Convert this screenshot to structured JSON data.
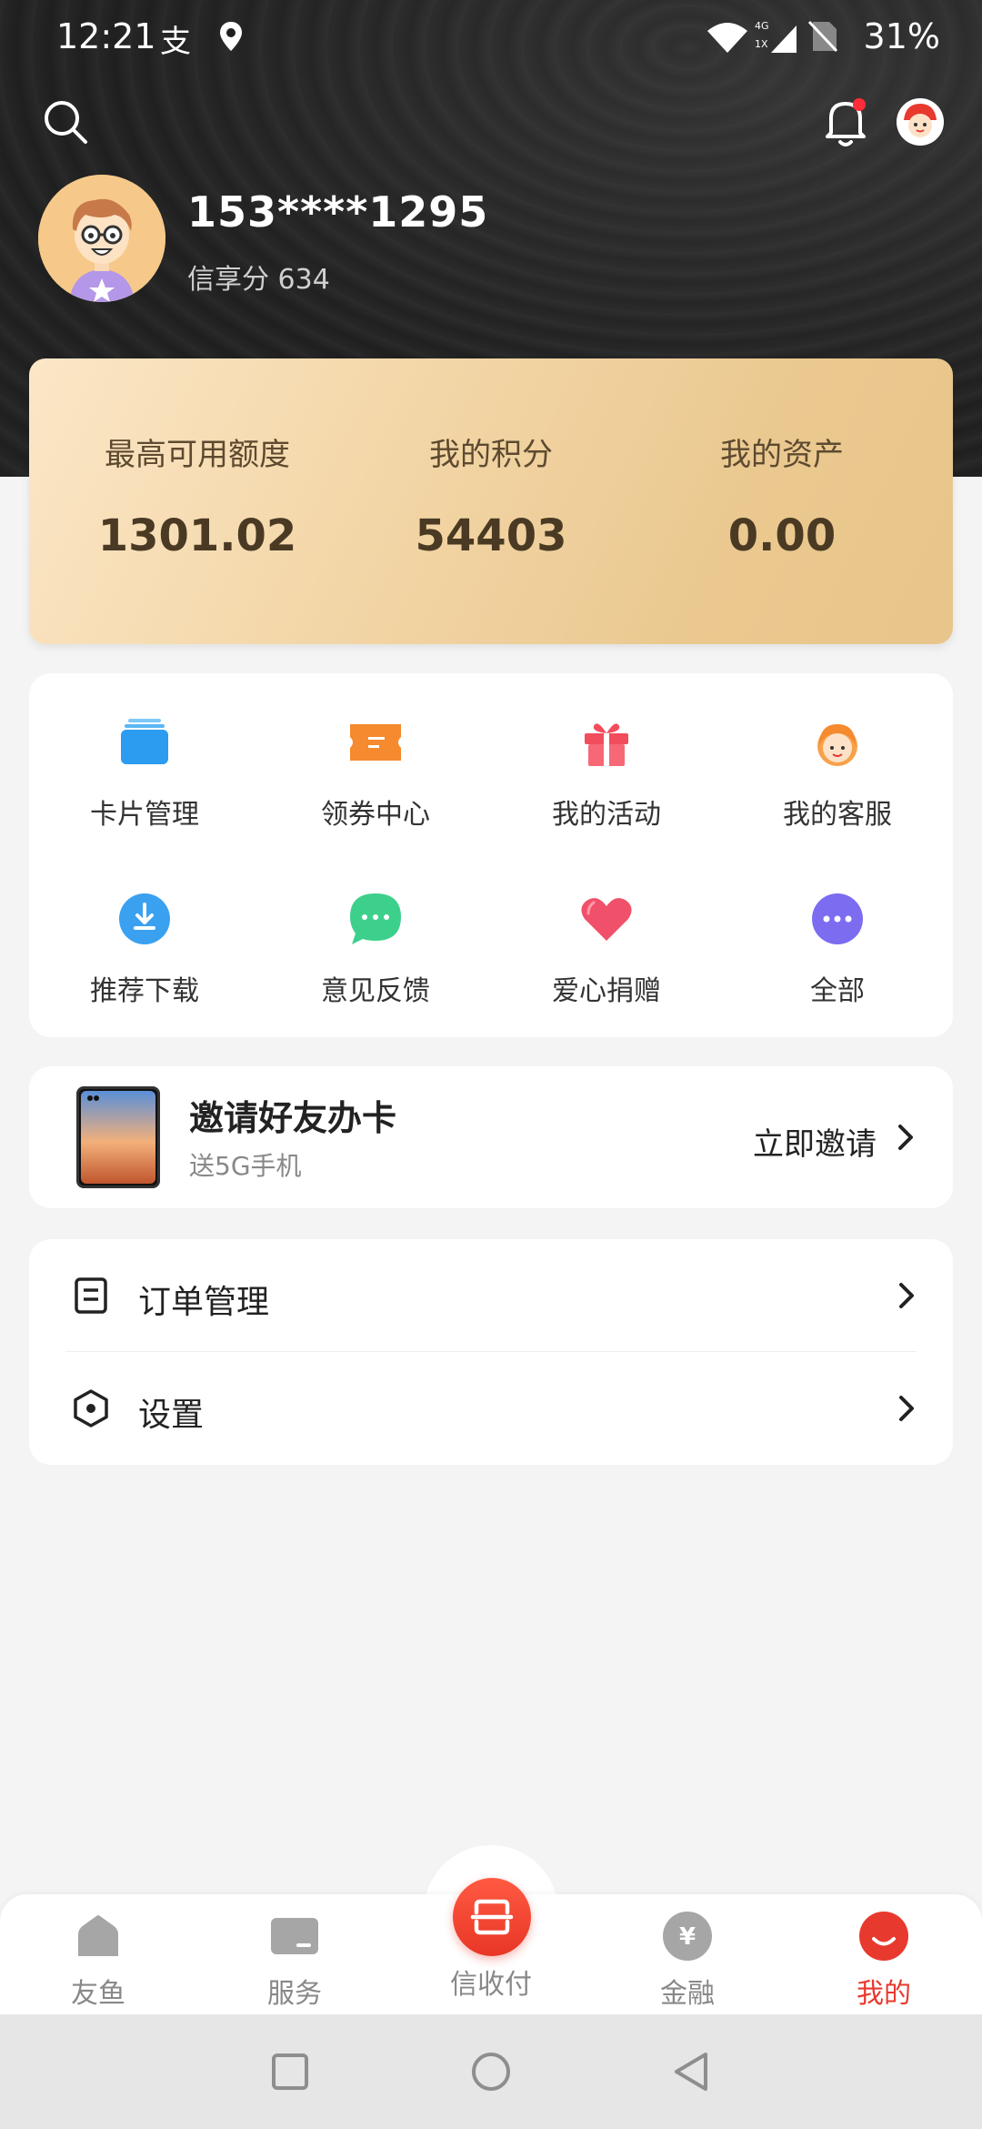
{
  "status_bar": {
    "time": "12:21",
    "battery": "31%"
  },
  "profile": {
    "name": "153****1295",
    "score_label": "信享分",
    "score_value": "634"
  },
  "assets": [
    {
      "label": "最高可用额度",
      "value": "1301.02"
    },
    {
      "label": "我的积分",
      "value": "54403"
    },
    {
      "label": "我的资产",
      "value": "0.00"
    }
  ],
  "shortcuts": [
    {
      "label": "卡片管理",
      "icon": "card-icon"
    },
    {
      "label": "领券中心",
      "icon": "coupon-icon"
    },
    {
      "label": "我的活动",
      "icon": "gift-icon"
    },
    {
      "label": "我的客服",
      "icon": "customer-service-icon"
    },
    {
      "label": "推荐下载",
      "icon": "download-icon"
    },
    {
      "label": "意见反馈",
      "icon": "feedback-icon"
    },
    {
      "label": "爱心捐赠",
      "icon": "heart-icon"
    },
    {
      "label": "全部",
      "icon": "more-icon"
    }
  ],
  "invite": {
    "title": "邀请好友办卡",
    "subtitle": "送5G手机",
    "action": "立即邀请"
  },
  "menu": [
    {
      "label": "订单管理",
      "icon": "order-icon"
    },
    {
      "label": "设置",
      "icon": "settings-icon"
    }
  ],
  "tabs": [
    {
      "label": "友鱼",
      "icon": "home-icon"
    },
    {
      "label": "服务",
      "icon": "service-icon"
    },
    {
      "label": "信收付",
      "icon": "scan-icon"
    },
    {
      "label": "金融",
      "icon": "yen-icon"
    },
    {
      "label": "我的",
      "icon": "profile-icon",
      "active": true
    }
  ],
  "colors": {
    "accent": "#e8392e",
    "gold": "#eac88f",
    "header": "#1e1e1e"
  }
}
